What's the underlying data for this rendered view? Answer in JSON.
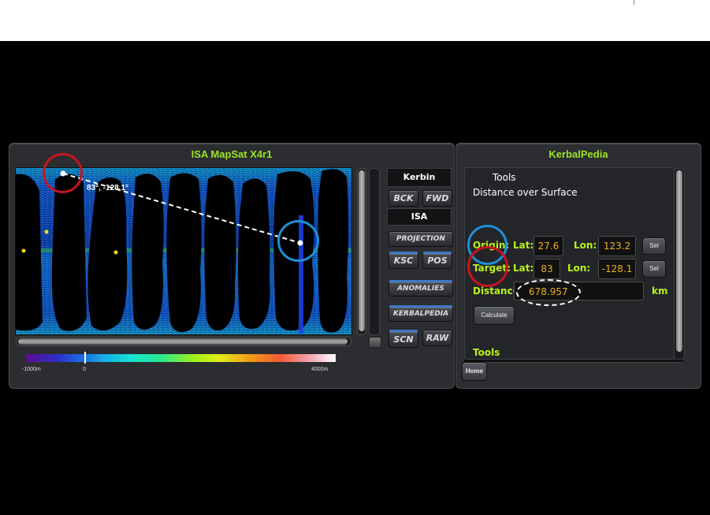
{
  "map_window": {
    "title": "ISA MapSat X4r1",
    "coord_label": "83°, -128.1°",
    "legend": {
      "min_label": "-1000m",
      "zero_label": "0",
      "max_label": "4000m"
    },
    "side": {
      "planet_label": "Kerbin",
      "back_label": "BCK",
      "forward_label": "FWD",
      "map_type_label": "ISA",
      "projection_label": "PROJECTION",
      "ksc_label": "KSC",
      "pos_label": "POS",
      "anomalies_label": "ANOMALIES",
      "kerbalpedia_label": "KERBALPEDIA",
      "scn_label": "SCN",
      "raw_label": "RAW"
    }
  },
  "kerbalpedia": {
    "title": "KerbalPedia",
    "tools_header": "Tools",
    "section_title": "Distance over Surface",
    "origin": {
      "label": "Origin:",
      "lat_label": "Lat:",
      "lat": "27.6",
      "lon_label": "Lon:",
      "lon": "123.2",
      "sel_label": "Sel"
    },
    "target": {
      "label": "Target:",
      "lat_label": "Lat:",
      "lat": "83",
      "lon_label": "Lon:",
      "lon": "-128.1",
      "sel_label": "Sel"
    },
    "distance": {
      "label": "Distance:",
      "value": "678.957",
      "unit": "km"
    },
    "calculate_label": "Calculate",
    "tools_footer": "Tools",
    "home_label": "Home"
  },
  "colors": {
    "title_green": "#9be51e",
    "value_orange": "#f0b020",
    "annotation_red": "#c8141e",
    "annotation_blue": "#1e90d8",
    "annotation_white": "#ffffff"
  }
}
